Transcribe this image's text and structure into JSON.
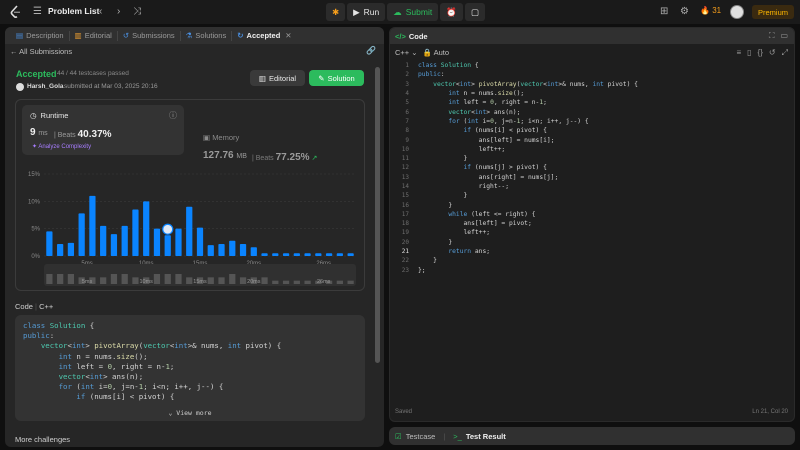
{
  "topbar": {
    "problem_list": "Problem List",
    "run": "Run",
    "submit": "Submit",
    "streak": "31",
    "premium": "Premium"
  },
  "left": {
    "tabs": [
      {
        "label": "Description",
        "icon": "description-icon"
      },
      {
        "label": "Editorial",
        "icon": "book-icon"
      },
      {
        "label": "Submissions",
        "icon": "history-icon"
      },
      {
        "label": "Solutions",
        "icon": "flask-icon"
      },
      {
        "label": "Accepted",
        "icon": "accepted-icon"
      }
    ],
    "back": "All Submissions",
    "status": "Accepted",
    "passed": "44 / 44 testcases passed",
    "user": "Harsh_Gola",
    "submitted": "submitted at Mar 03, 2025 20:16",
    "editorial_btn": "Editorial",
    "solution_btn": "Solution",
    "runtime": {
      "title": "Runtime",
      "value": "9",
      "unit": "ms",
      "beats_label": "Beats",
      "beats": "40.37%",
      "analyze": "Analyze Complexity"
    },
    "memory": {
      "title": "Memory",
      "value": "127.76",
      "unit": "MB",
      "beats_label": "Beats",
      "beats": "77.25%"
    },
    "code_label": "Code",
    "code_lang": "C++",
    "view_more": "View more",
    "more_challenges": "More challenges",
    "code_lines": [
      "class Solution {",
      "public:",
      "    vector<int> pivotArray(vector<int>& nums, int pivot) {",
      "        int n = nums.size();",
      "        int left = 0, right = n-1;",
      "        vector<int> ans(n);",
      "        for (int i=0, j=n-1; i<n; i++, j--) {",
      "            if (nums[i] < pivot) {"
    ]
  },
  "chart_data": {
    "type": "bar",
    "yticks": [
      "15%",
      "10%",
      "5%",
      "0%"
    ],
    "ylim": [
      0,
      15
    ],
    "xticks": [
      "5ms",
      "10ms",
      "15ms",
      "20ms",
      "26ms"
    ],
    "values": [
      4.5,
      2.2,
      2.4,
      7.8,
      11.0,
      5.5,
      4.0,
      5.5,
      8.5,
      10.0,
      5.0,
      3.8,
      5.0,
      9.0,
      5.2,
      2.0,
      2.2,
      2.8,
      2.2,
      1.6,
      0.5,
      0.5,
      0.5,
      0.5,
      0.5,
      0.5,
      0.5,
      0.5,
      0.5
    ],
    "highlight_index": 11,
    "mini_values": [
      3,
      3,
      3,
      2,
      2,
      2,
      3,
      3,
      2,
      2,
      3,
      3,
      3,
      2,
      2,
      2,
      2,
      3,
      2,
      2,
      2,
      1,
      1,
      1,
      1,
      1,
      1,
      1,
      1
    ],
    "mini_xticks": [
      "5ms",
      "10ms",
      "15ms",
      "20ms",
      "26ms"
    ],
    "colors": {
      "bar": "#0a84ff",
      "mini": "#555555"
    }
  },
  "right": {
    "title": "Code",
    "lang": "C++",
    "auto": "Auto",
    "saved": "Saved",
    "cursor": "Ln 21, Col 20",
    "lines": [
      "class Solution {",
      "public:",
      "    vector<int> pivotArray(vector<int>& nums, int pivot) {",
      "        int n = nums.size();",
      "        int left = 0, right = n-1;",
      "        vector<int> ans(n);",
      "        for (int i=0, j=n-1; i<n; i++, j--) {",
      "            if (nums[i] < pivot) {",
      "                ans[left] = nums[i];",
      "                left++;",
      "            }",
      "            if (nums[j] > pivot) {",
      "                ans[right] = nums[j];",
      "                right--;",
      "            }",
      "        }",
      "        while (left <= right) {",
      "            ans[left] = pivot;",
      "            left++;",
      "        }",
      "        return ans;",
      "    }",
      "};"
    ],
    "current_line": 21
  },
  "bottom": {
    "testcase": "Testcase",
    "test_result": "Test Result"
  }
}
